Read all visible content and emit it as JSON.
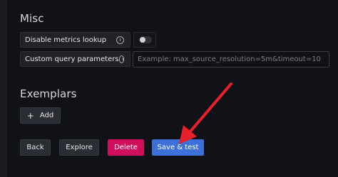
{
  "sections": {
    "misc_title": "Misc",
    "exemplars_title": "Exemplars"
  },
  "misc": {
    "disable_metrics_lookup_label": "Disable metrics lookup",
    "disable_metrics_lookup_enabled": false,
    "custom_query_parameters_label": "Custom query parameters",
    "custom_query_parameters_value": "",
    "custom_query_parameters_placeholder": "Example: max_source_resolution=5m&timeout=10"
  },
  "exemplars": {
    "add_label": "Add"
  },
  "actions": {
    "back_label": "Back",
    "explore_label": "Explore",
    "delete_label": "Delete",
    "save_test_label": "Save & test"
  },
  "colors": {
    "background": "#111217",
    "delete": "#d10e5c",
    "primary": "#3d71d9",
    "annotation_arrow": "#e8202a"
  },
  "icons": {
    "info": "info-icon",
    "plus": "plus-icon",
    "annotation": "arrow-annotation"
  }
}
